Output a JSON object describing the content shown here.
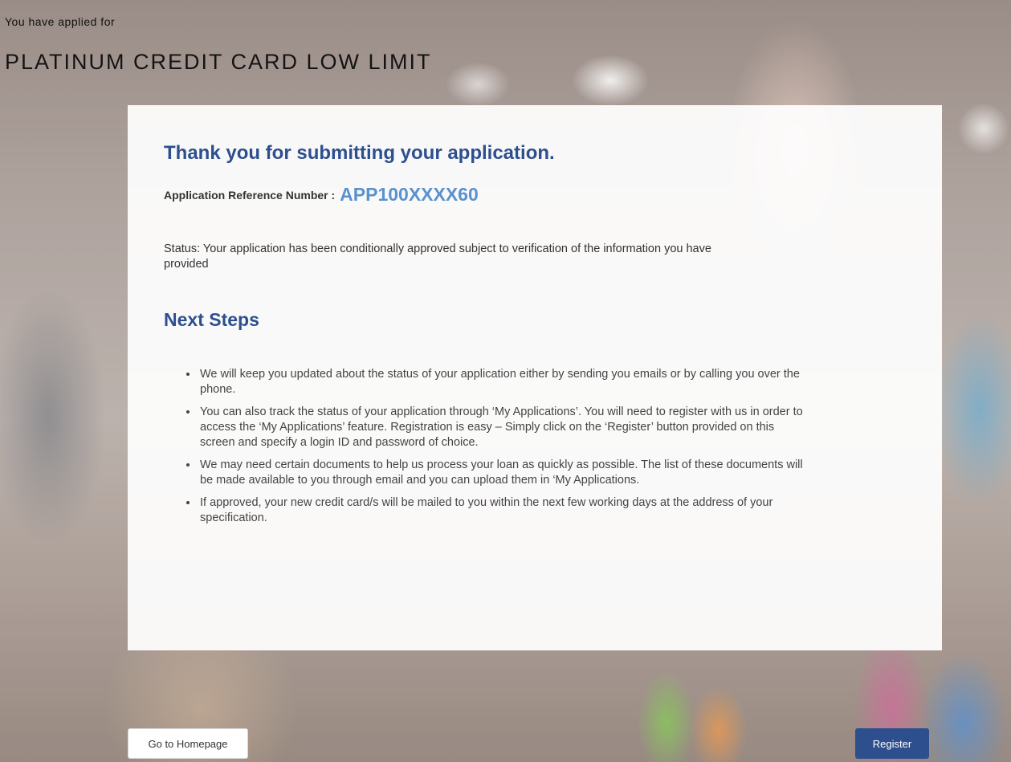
{
  "header": {
    "applied_for_label": "You have applied for",
    "product_name": "PLATINUM CREDIT CARD LOW LIMIT"
  },
  "confirmation": {
    "thank_you": "Thank you for submitting your application.",
    "reference_label": "Application Reference Number :",
    "reference_number": "APP100XXXX60",
    "status_text": "Status: Your application has been conditionally approved subject to verification of the information you have provided"
  },
  "next_steps": {
    "title": "Next Steps",
    "items": [
      "We will keep you updated about the status of your application either by sending you emails or by calling you over the phone.",
      "You can also track the status of your application through ‘My Applications’. You will need to register with us in order to access the ‘My Applications’ feature. Registration is easy – Simply click on the ‘Register’ button provided on this screen and specify a login ID and password of choice.",
      "We may need certain documents to help us process your loan as quickly as possible. The list of these documents will be made available to you through email and you can upload them in ‘My Applications.",
      "If approved, your new credit card/s will be mailed to you within the next few working days at the address of your specification."
    ]
  },
  "actions": {
    "home_label": "Go to Homepage",
    "register_label": "Register"
  },
  "colors": {
    "primary": "#2d4f8e",
    "reference_accent": "#5b91cf"
  }
}
